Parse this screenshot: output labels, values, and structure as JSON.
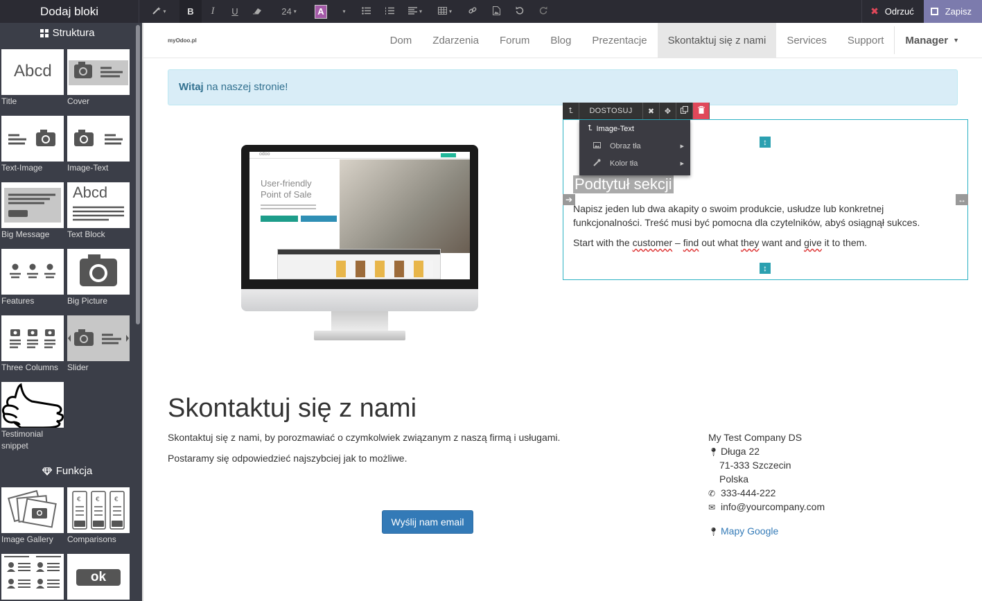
{
  "editor": {
    "title": "Dodaj bloki",
    "font_size": "24",
    "color_letter": "A",
    "discard_label": "Odrzuć",
    "save_label": "Zapisz"
  },
  "sidebar": {
    "section_structure": "Struktura",
    "section_feature": "Funkcja",
    "tiles": [
      {
        "label": "Title"
      },
      {
        "label": "Cover"
      },
      {
        "label": "Text-Image"
      },
      {
        "label": "Image-Text"
      },
      {
        "label": "Big Message"
      },
      {
        "label": "Text Block"
      },
      {
        "label": "Features"
      },
      {
        "label": "Big Picture"
      },
      {
        "label": "Three Columns"
      },
      {
        "label": "Slider"
      },
      {
        "label": "Testimonial snippet"
      },
      {
        "label": "Image Gallery"
      },
      {
        "label": "Comparisons"
      }
    ],
    "thumb_text_abcd": "Abcd",
    "thumb_text_ok": "ok"
  },
  "site": {
    "logo": "myOdoo.pl",
    "nav": [
      "Dom",
      "Zdarzenia",
      "Forum",
      "Blog",
      "Prezentacje",
      "Skontaktuj się z nami",
      "Services",
      "Support"
    ],
    "nav_active": "Skontaktuj się z nami",
    "manager": "Manager",
    "alert_bold": "Witaj",
    "alert_text": " na naszej stronie!",
    "monitor": {
      "logo": "odoo",
      "headline1": "User-friendly",
      "headline2": "Point of Sale"
    },
    "block": {
      "title": "Podtytuł sekcji",
      "p1": "Napisz jeden lub dwa akapity o swoim produkcie, usłudze lub konkretnej funkcjonalności. Treść musi być pomocna dla czytelników, abyś osiągnął sukces.",
      "p2_a": "Start with the ",
      "p2_customer": "customer",
      "p2_b": " – ",
      "p2_find": "find",
      "p2_c": " out what ",
      "p2_they": "they",
      "p2_d": " want and ",
      "p2_give": "give",
      "p2_e": " it to them."
    },
    "overlay": {
      "customize": "DOSTOSUJ",
      "menu_header": "Image-Text",
      "item_bg_image": "Obraz tła",
      "item_bg_color": "Kolor tła"
    },
    "contact": {
      "heading": "Skontaktuj się z nami",
      "p1": "Skontaktuj się z nami, by porozmawiać o czymkolwiek związanym z naszą firmą i usługami.",
      "p2": "Postaramy się odpowiedzieć najszybciej jak to możliwe.",
      "button": "Wyślij nam email",
      "company": "My Test Company DS",
      "street": "Długa 22",
      "city": "71-333 Szczecin",
      "country": "Polska",
      "phone": "333-444-222",
      "email": "info@yourcompany.com",
      "maps": "Mapy Google"
    }
  },
  "colors": {
    "editor_bar": "#2b2b33",
    "sidebar": "#3b3e48",
    "save": "#7c7bad",
    "discard_icon": "#e0485a",
    "alert_bg": "#d9edf7",
    "link": "#337ab7",
    "block_border": "#2bb1c3"
  }
}
